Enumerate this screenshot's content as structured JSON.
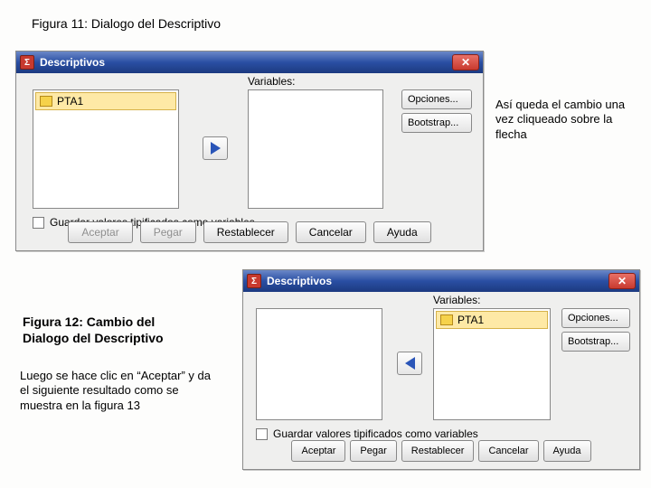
{
  "figure11": {
    "caption": "Figura 11: Dialogo del Descriptivo",
    "annotation": "Así queda el cambio una vez cliqueado sobre la flecha",
    "dialog": {
      "title": "Descriptivos",
      "vars_label": "Variables:",
      "item": "PTA1",
      "options_btn": "Opciones...",
      "bootstrap_btn": "Bootstrap...",
      "checkbox_label": "Guardar valores tipificados como variables",
      "buttons": {
        "aceptar": "Aceptar",
        "pegar": "Pegar",
        "restablecer": "Restablecer",
        "cancelar": "Cancelar",
        "ayuda": "Ayuda"
      }
    }
  },
  "figure12": {
    "caption": "Figura 12: Cambio del Dialogo del Descriptivo",
    "followup": "Luego se hace clic en “Aceptar” y da el siguiente resultado como se muestra en la figura 13",
    "dialog": {
      "title": "Descriptivos",
      "vars_label": "Variables:",
      "item": "PTA1",
      "options_btn": "Opciones...",
      "bootstrap_btn": "Bootstrap...",
      "checkbox_label": "Guardar valores tipificados como variables",
      "buttons": {
        "aceptar": "Aceptar",
        "pegar": "Pegar",
        "restablecer": "Restablecer",
        "cancelar": "Cancelar",
        "ayuda": "Ayuda"
      }
    }
  }
}
